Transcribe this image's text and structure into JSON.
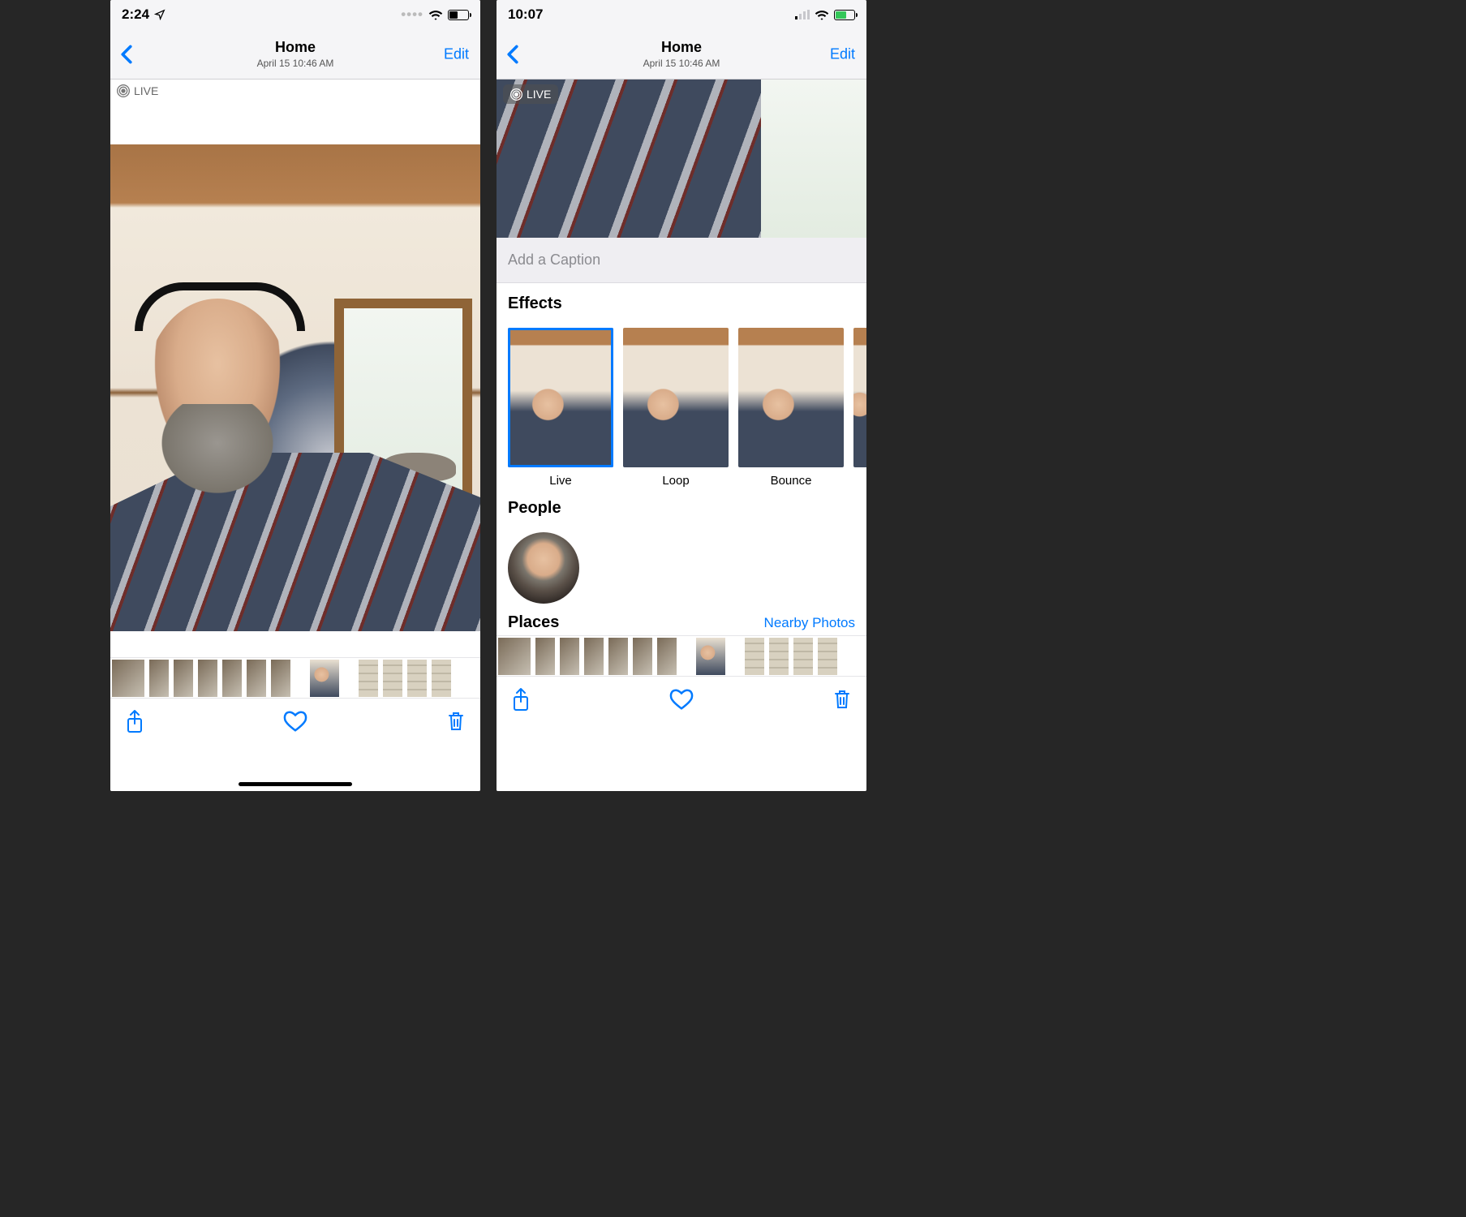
{
  "left": {
    "status": {
      "time": "2:24"
    },
    "nav": {
      "title": "Home",
      "subtitle": "April 15  10:46 AM",
      "edit": "Edit"
    },
    "live_badge": "LIVE"
  },
  "right": {
    "status": {
      "time": "10:07"
    },
    "nav": {
      "title": "Home",
      "subtitle": "April 15  10:46 AM",
      "edit": "Edit"
    },
    "live_badge": "LIVE",
    "caption_placeholder": "Add a Caption",
    "effects_heading": "Effects",
    "effects": {
      "live": "Live",
      "loop": "Loop",
      "bounce": "Bounce"
    },
    "people_heading": "People",
    "places_heading": "Places",
    "nearby_label": "Nearby Photos"
  }
}
